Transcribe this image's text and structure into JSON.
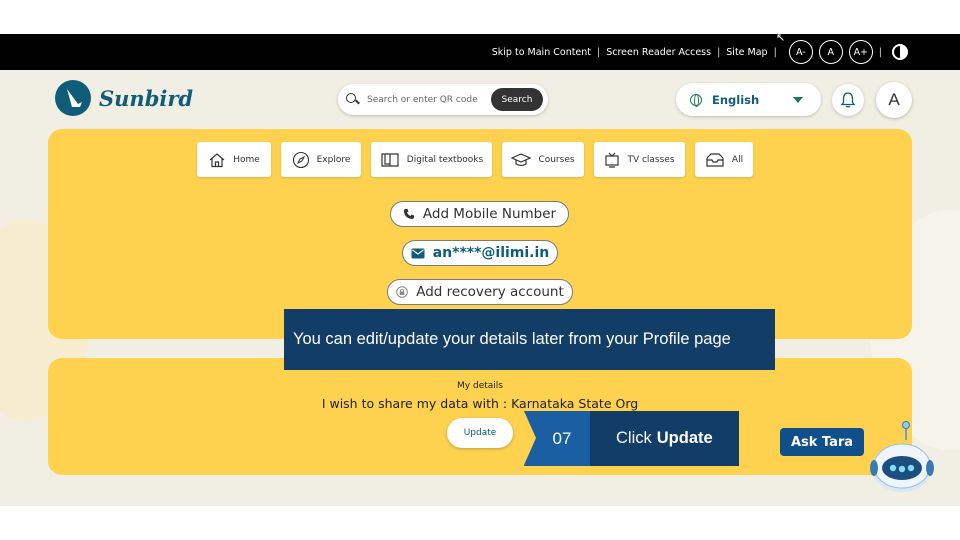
{
  "topbar": {
    "skip": "Skip to Main Content",
    "screen_reader": "Screen Reader Access",
    "site_map": "Site Map",
    "font_decrease": "A-",
    "font_normal": "A",
    "font_increase": "A+",
    "separator": "|"
  },
  "header": {
    "brand": "Sunbird",
    "search_placeholder": "Search or enter QR code",
    "search_button": "Search",
    "language": "English",
    "avatar_letter": "A"
  },
  "nav": {
    "tabs": [
      {
        "label": "Home",
        "icon": "home-icon"
      },
      {
        "label": "Explore",
        "icon": "compass-icon"
      },
      {
        "label": "Digital textbooks",
        "icon": "book-icon"
      },
      {
        "label": "Courses",
        "icon": "graduation-cap-icon"
      },
      {
        "label": "TV classes",
        "icon": "tv-icon"
      },
      {
        "label": "All",
        "icon": "inbox-icon"
      }
    ]
  },
  "contact": {
    "add_mobile": "Add Mobile Number",
    "email": "an****@ilimi.in",
    "add_recovery": "Add recovery account"
  },
  "tooltip": {
    "text": "You can edit/update your details later from your Profile page"
  },
  "details": {
    "title": "My details",
    "share_text": "I wish to share my data with : Karnataka State Org",
    "update_button": "Update"
  },
  "step": {
    "number": "07",
    "label_prefix": "Click",
    "label_bold": "Update"
  },
  "assistant": {
    "label": "Ask Tara"
  },
  "colors": {
    "brand": "#0f5d79",
    "card_yellow": "#fed24f",
    "tooltip_navy": "#123d66",
    "step_blue": "#1b5fa3",
    "background": "#f1eee3"
  }
}
